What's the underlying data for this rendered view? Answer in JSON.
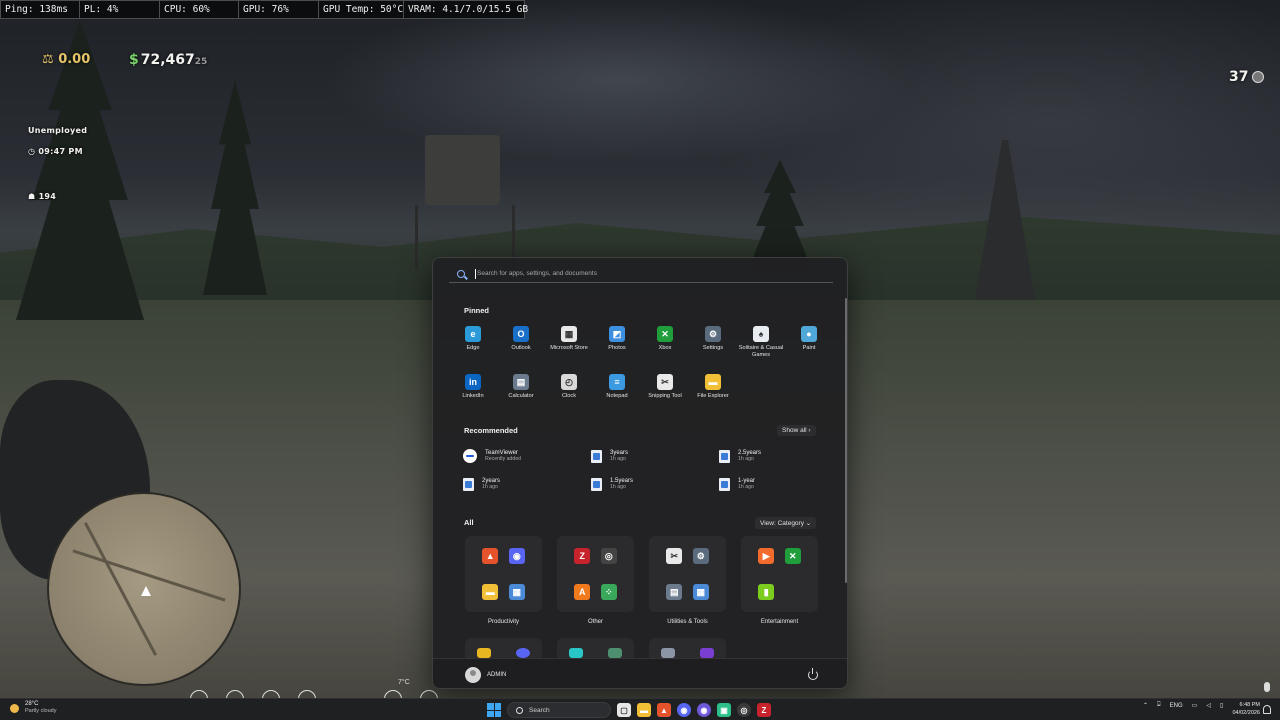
{
  "overlay": {
    "cells": [
      "Ping: 138ms",
      "PL: 4%",
      "CPU: 60%",
      "GPU: 76%",
      "GPU Temp: 50°C",
      "VRAM: 4.1/7.0/15.5 GB"
    ]
  },
  "hud": {
    "gold": "0.00",
    "money_symbol": "$",
    "money": "72,467",
    "money_cents": "25",
    "level": "37",
    "job": "Unemployed",
    "time": "09:47 PM",
    "honor": "194",
    "temp_small": "7°C"
  },
  "start_menu": {
    "search_placeholder": "Search for apps, settings, and documents",
    "pinned_title": "Pinned",
    "pinned": [
      {
        "label": "Edge",
        "icon": "edge-icon",
        "color": "#2a9bd8",
        "glyph": "e"
      },
      {
        "label": "Outlook",
        "icon": "outlook-icon",
        "color": "#1a6fc9",
        "glyph": "O"
      },
      {
        "label": "Microsoft Store",
        "icon": "store-icon",
        "color": "#e8e8e8",
        "glyph": "▦"
      },
      {
        "label": "Photos",
        "icon": "photos-icon",
        "color": "#3d8fe0",
        "glyph": "◩"
      },
      {
        "label": "Xbox",
        "icon": "xbox-icon",
        "color": "#1f9e3b",
        "glyph": "✕"
      },
      {
        "label": "Settings",
        "icon": "settings-gear-icon",
        "color": "#5b6b7e",
        "glyph": "⚙"
      },
      {
        "label": "Solitaire & Casual Games",
        "icon": "solitaire-icon",
        "color": "#e9edf2",
        "glyph": "♠"
      },
      {
        "label": "Paint",
        "icon": "paint-icon",
        "color": "#4fa8d8",
        "glyph": "●"
      },
      {
        "label": "LinkedIn",
        "icon": "linkedin-icon",
        "color": "#0a66c2",
        "glyph": "in"
      },
      {
        "label": "Calculator",
        "icon": "calculator-icon",
        "color": "#6b7a8c",
        "glyph": "▤"
      },
      {
        "label": "Clock",
        "icon": "clock-icon",
        "color": "#d9d9d9",
        "glyph": "◴"
      },
      {
        "label": "Notepad",
        "icon": "notepad-icon",
        "color": "#3b9ae0",
        "glyph": "≡"
      },
      {
        "label": "Snipping Tool",
        "icon": "snipping-tool-icon",
        "color": "#e9e9e9",
        "glyph": "✂"
      },
      {
        "label": "File Explorer",
        "icon": "file-explorer-icon",
        "color": "#f2c037",
        "glyph": "▬"
      }
    ],
    "recommended_title": "Recommended",
    "show_all": "Show all",
    "recommended": [
      {
        "name": "TeamViewer",
        "sub": "Recently added",
        "type": "teamviewer-icon"
      },
      {
        "name": "3years",
        "sub": "1h ago",
        "type": "document-icon"
      },
      {
        "name": "2.5years",
        "sub": "1h ago",
        "type": "document-icon"
      },
      {
        "name": "2years",
        "sub": "1h ago",
        "type": "document-icon"
      },
      {
        "name": "1.5years",
        "sub": "1h ago",
        "type": "document-icon"
      },
      {
        "name": "1-year",
        "sub": "1h ago",
        "type": "document-icon"
      }
    ],
    "all_title": "All",
    "view_label": "View: Category",
    "categories": [
      {
        "label": "Productivity",
        "icons": [
          [
            "brave-icon",
            "#e5532d",
            "▲"
          ],
          [
            "discord-icon",
            "#5865f2",
            "◉"
          ],
          [
            "file-explorer-icon",
            "#f2c037",
            "▬"
          ],
          [
            "control-panel-icon",
            "#4b8ad6",
            "▦"
          ]
        ]
      },
      {
        "label": "Other",
        "icons": [
          [
            "filezilla-icon",
            "#c7232d",
            "Z"
          ],
          [
            "steam-icon",
            "#444",
            "◎"
          ],
          [
            "avast-icon",
            "#f07a1c",
            "A"
          ],
          [
            "dice-icon",
            "#3aa85a",
            "⁘"
          ]
        ]
      },
      {
        "label": "Utilities & Tools",
        "icons": [
          [
            "snipping-tool-icon",
            "#e9e9e9",
            "✂"
          ],
          [
            "settings-gear-icon",
            "#5b6b7e",
            "⚙"
          ],
          [
            "calculator-icon",
            "#6b7a8c",
            "▤"
          ],
          [
            "control-panel-icon",
            "#4b8ad6",
            "▦"
          ]
        ]
      },
      {
        "label": "Entertainment",
        "icons": [
          [
            "media-player-icon",
            "#f06b2c",
            "▶"
          ],
          [
            "xbox-icon",
            "#1f9e3b",
            "✕"
          ],
          [
            "game-bar-icon",
            "#7ccc1f",
            "▮"
          ]
        ]
      }
    ],
    "user": "ADMIN"
  },
  "taskbar": {
    "temp": "28°C",
    "condition": "Partly cloudy",
    "search_label": "Search",
    "lang": "ENG",
    "time": "6:48 PM",
    "date": "04/02/2026"
  }
}
